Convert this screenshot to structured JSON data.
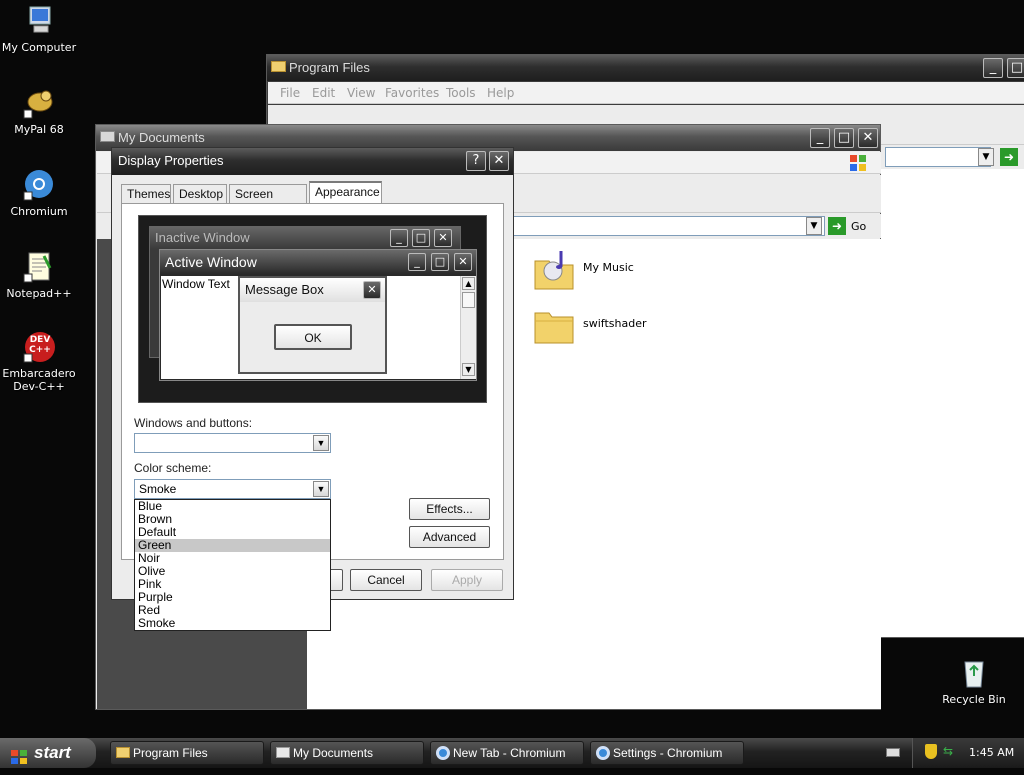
{
  "desktop": {
    "icons": [
      {
        "label": "My Computer"
      },
      {
        "label": "MyPal 68"
      },
      {
        "label": "Chromium"
      },
      {
        "label": "Notepad++"
      },
      {
        "label": "Embarcadero Dev-C++"
      },
      {
        "label": "Recycle Bin"
      }
    ],
    "devcpp_badge": "DEV C++"
  },
  "program_files": {
    "title": "Program Files",
    "menu": [
      "File",
      "Edit",
      "View",
      "Favorites",
      "Tools",
      "Help"
    ]
  },
  "my_documents": {
    "title": "My Documents",
    "go_label": "Go",
    "items": [
      {
        "label": "My Music"
      },
      {
        "label": "swiftshader"
      }
    ]
  },
  "display_properties": {
    "title": "Display Properties",
    "help_glyph": "?",
    "tabs": [
      "Themes",
      "Desktop",
      "Screen Saver",
      "Appearance"
    ],
    "preview": {
      "inactive_title": "Inactive Window",
      "active_title": "Active Window",
      "window_text": "Window Text",
      "message_box_title": "Message Box",
      "ok_label": "OK"
    },
    "windows_buttons_label": "Windows and buttons:",
    "windows_buttons_value": "",
    "color_scheme_label": "Color scheme:",
    "color_scheme_value": "Smoke",
    "color_scheme_options": [
      "Blue",
      "Brown",
      "Default",
      "Green",
      "Noir",
      "Olive",
      "Pink",
      "Purple",
      "Red",
      "Smoke"
    ],
    "color_scheme_highlighted": "Green",
    "effects_label": "Effects...",
    "advanced_label": "Advanced",
    "cancel_label": "Cancel",
    "apply_label": "Apply"
  },
  "taskbar": {
    "start_label": "start",
    "buttons": [
      {
        "label": "Program Files"
      },
      {
        "label": "My Documents"
      },
      {
        "label": "New Tab - Chromium"
      },
      {
        "label": "Settings - Chromium"
      }
    ],
    "clock": "1:45 AM"
  },
  "colors": {
    "desktop_bg": "#080808",
    "titlebar": "#2e2e2e",
    "dropdown_highlight": "#c8c8c8",
    "folder_yellow": "#f0d070"
  }
}
